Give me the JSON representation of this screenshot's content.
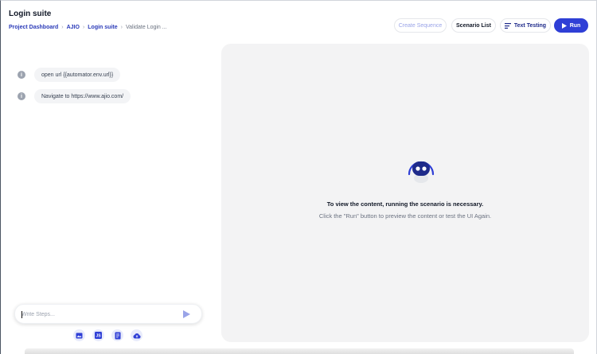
{
  "header": {
    "title": "Login suite",
    "breadcrumb": [
      {
        "label": "Project Dashboard"
      },
      {
        "label": "AJIO"
      },
      {
        "label": "Login suite"
      },
      {
        "label": "Validate Login ..."
      }
    ]
  },
  "toolbar": {
    "create_sequence": "Create Sequence",
    "scenario_list": "Scenario List",
    "text_testing": "Text Testing",
    "run": "Run"
  },
  "steps": [
    {
      "text": "open url {{automator.env.url}}"
    },
    {
      "text": "Navigate to https://www.ajio.com/"
    }
  ],
  "composer": {
    "placeholder": "Write Steps..."
  },
  "preview": {
    "message": "To view the content, running the scenario is necessary.",
    "hint": "Click the \"Run\" button to preview the content or test the UI Again."
  },
  "colors": {
    "accent": "#2f3fd6",
    "breadcrumb_link": "#2a3ab8",
    "panel_bg": "#f3f3f4"
  },
  "icons": [
    "info-icon",
    "send-icon",
    "image-icon",
    "js-icon",
    "document-icon",
    "cloud-upload-icon",
    "robot-icon",
    "play-icon",
    "text-lines-icon"
  ]
}
